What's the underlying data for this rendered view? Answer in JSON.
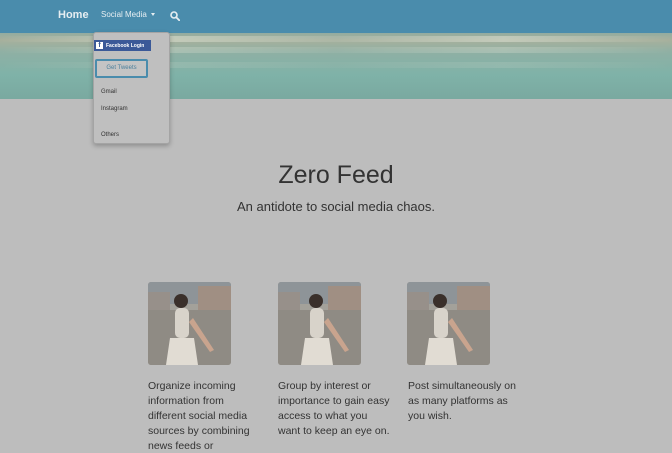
{
  "navbar": {
    "home_label": "Home",
    "social_label": "Social Media",
    "search_icon": "search-icon"
  },
  "dropdown": {
    "facebook_label": "Facebook Login",
    "tweets_label": "Get Tweets",
    "items": [
      "Gmail",
      "Instagram",
      "Others"
    ]
  },
  "hero": {
    "title": "Zero Feed",
    "subtitle": "An antidote to social media chaos."
  },
  "features": [
    {
      "text": "Organize incoming information from different social media sources by combining news feeds or"
    },
    {
      "text": "Group by interest or importance to gain easy access to what you want to keep an eye on."
    },
    {
      "text": "Post simultaneously on as many platforms as you wish."
    }
  ],
  "colors": {
    "navbar": "#4a8cac",
    "facebook": "#3b5998",
    "page_background": "#bdbdbd"
  }
}
